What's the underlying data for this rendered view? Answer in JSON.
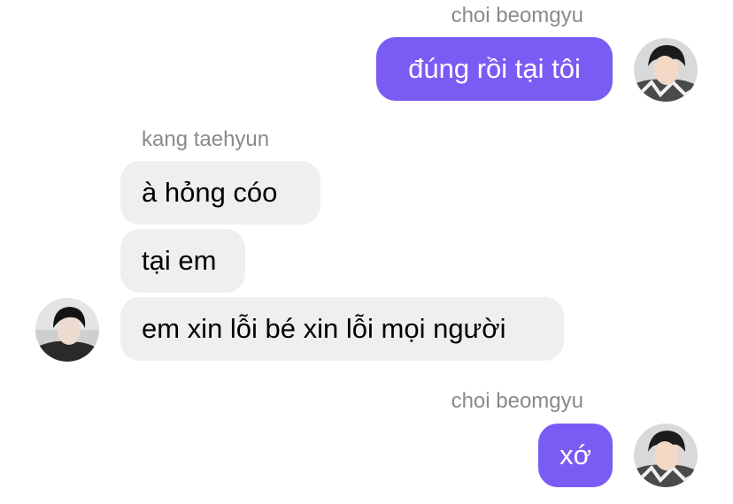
{
  "thread": {
    "group1": {
      "sender": "choi beomgyu",
      "avatar_icon": "profile-avatar-icon",
      "messages": [
        "đúng rồi tại tôi"
      ]
    },
    "group2": {
      "sender": "kang taehyun",
      "avatar_icon": "profile-avatar-icon",
      "messages": [
        "à hỏng cóo",
        "tại em",
        "em xin lỗi bé xin lỗi mọi người"
      ]
    },
    "group3": {
      "sender": "choi beomgyu",
      "avatar_icon": "profile-avatar-icon",
      "messages": [
        "xớ"
      ]
    }
  },
  "colors": {
    "outgoing_bubble": "#7a5cf5",
    "incoming_bubble": "#efefef",
    "sender_name": "#8a8a8e"
  }
}
